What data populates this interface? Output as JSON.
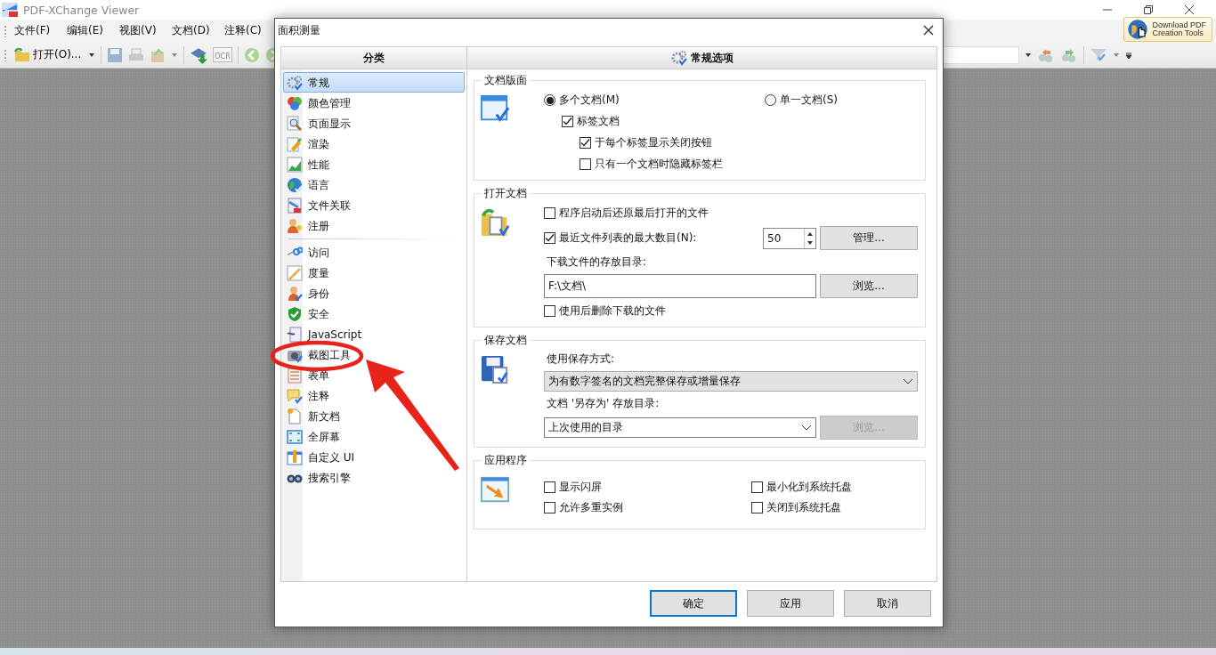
{
  "app": {
    "title": "PDF-XChange Viewer",
    "menu": [
      "文件(F)",
      "编辑(E)",
      "视图(V)",
      "文档(D)",
      "注释(C)"
    ],
    "toolbar": {
      "open_button": "打开(O)...",
      "ocr_label": "OCR"
    },
    "download_button": [
      "Download PDF",
      "Creation Tools"
    ]
  },
  "dialog": {
    "title": "面积测量",
    "sidebar": {
      "header": "分类",
      "groups": [
        {
          "items": [
            {
              "label": "常规",
              "selected": true
            },
            {
              "label": "颜色管理",
              "selected": false
            },
            {
              "label": "页面显示",
              "selected": false
            },
            {
              "label": "渲染",
              "selected": false
            },
            {
              "label": "性能",
              "selected": false
            },
            {
              "label": "语言",
              "selected": false
            },
            {
              "label": "文件关联",
              "selected": false
            },
            {
              "label": "注册",
              "selected": false
            }
          ]
        },
        {
          "items": [
            {
              "label": "访问",
              "selected": false
            },
            {
              "label": "度量",
              "selected": false
            },
            {
              "label": "身份",
              "selected": false
            },
            {
              "label": "安全",
              "selected": false
            },
            {
              "label": "JavaScript",
              "selected": false
            },
            {
              "label": "截图工具",
              "selected": false
            },
            {
              "label": "表单",
              "selected": false
            },
            {
              "label": "注释",
              "selected": false
            },
            {
              "label": "新文档",
              "selected": false
            },
            {
              "label": "全屏幕",
              "selected": false
            },
            {
              "label": "自定义 UI",
              "selected": false
            },
            {
              "label": "搜索引擎",
              "selected": false
            }
          ]
        }
      ]
    },
    "panel": {
      "header": "常规选项",
      "sections": [
        {
          "title": "文档版面",
          "rows": [
            {
              "kind": "radios",
              "options": [
                {
                  "label": "多个文档(M)",
                  "selected": true
                },
                {
                  "label": "单一文档(S)",
                  "selected": false
                }
              ]
            },
            {
              "kind": "checkbox",
              "label": "标签文档",
              "checked": true,
              "children": [
                {
                  "label": "于每个标签显示关闭按钮",
                  "checked": true
                },
                {
                  "label": "只有一个文档时隐藏标签栏",
                  "checked": false
                }
              ]
            }
          ]
        },
        {
          "title": "打开文档",
          "rows": [
            {
              "kind": "checkbox",
              "label": "程序启动后还原最后打开的文件",
              "checked": false
            },
            {
              "kind": "checkbox_spin",
              "label": "最近文件列表的最大数目(N):",
              "checked": true,
              "value": "50",
              "button": {
                "label": "管理...",
                "disabled": false
              }
            },
            {
              "kind": "label",
              "text": "下载文件的存放目录:"
            },
            {
              "kind": "path",
              "value": "F:\\文档\\",
              "button": {
                "label": "浏览...",
                "disabled": false
              }
            },
            {
              "kind": "checkbox",
              "label": "使用后删除下载的文件",
              "checked": false
            }
          ]
        },
        {
          "title": "保存文档",
          "rows": [
            {
              "kind": "label",
              "text": "使用保存方式:"
            },
            {
              "kind": "select",
              "value": "为有数字签名的文档完整保存或增量保存",
              "editable": false
            },
            {
              "kind": "label",
              "text": "文档 '另存为' 存放目录:"
            },
            {
              "kind": "select",
              "value": "上次使用的目录",
              "editable": true,
              "button": {
                "label": "浏览...",
                "disabled": true
              }
            }
          ]
        },
        {
          "title": "应用程序",
          "rows": [
            {
              "kind": "checkbox_grid",
              "items": [
                {
                  "label": "显示闪屏",
                  "checked": false
                },
                {
                  "label": "最小化到系统托盘",
                  "checked": false
                },
                {
                  "label": "允许多重实例",
                  "checked": false
                },
                {
                  "label": "关闭到系统托盘",
                  "checked": false
                }
              ]
            }
          ]
        }
      ]
    },
    "buttons": [
      {
        "label": "确定",
        "default": true
      },
      {
        "label": "应用",
        "default": false
      },
      {
        "label": "取消",
        "default": false
      }
    ]
  },
  "annotations": [
    {
      "kind": "ellipse"
    },
    {
      "kind": "arrow"
    }
  ]
}
